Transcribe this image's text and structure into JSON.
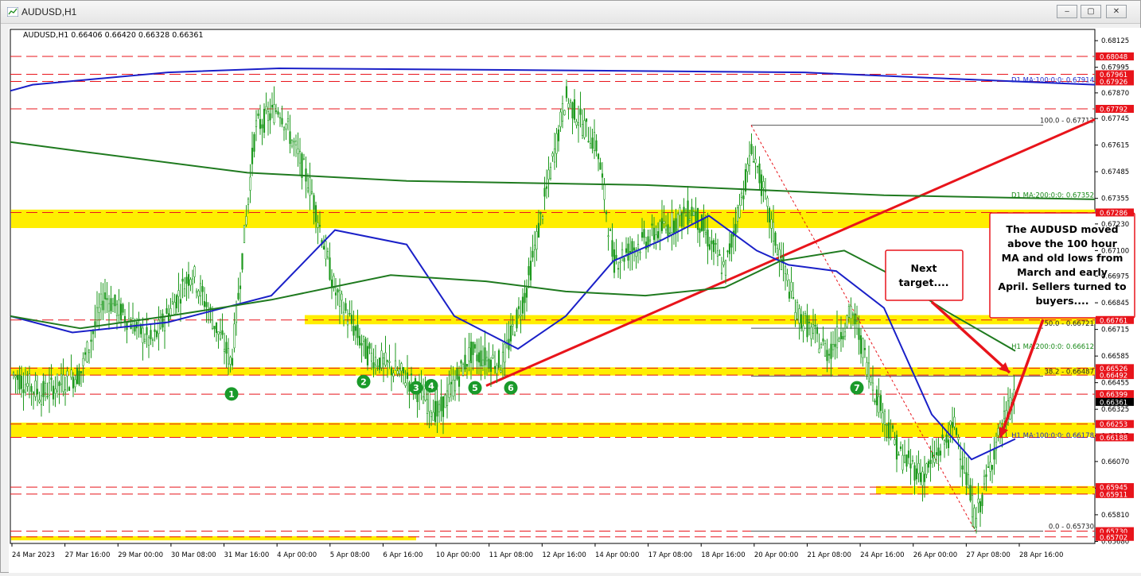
{
  "window": {
    "title": "AUDUSD,H1",
    "controls": {
      "minimize": "‒",
      "maximize": "▢",
      "close": "✕"
    }
  },
  "chart_data": {
    "type": "candlestick",
    "symbol_header": "AUDUSD,H1  0.66406 0.66420 0.66328 0.66361",
    "ylim": [
      0.6567,
      0.6818
    ],
    "price_axis_ticks": [
      "0.68125",
      "0.67995",
      "0.67870",
      "0.67745",
      "0.67615",
      "0.67485",
      "0.67355",
      "0.67230",
      "0.67100",
      "0.66975",
      "0.66845",
      "0.66715",
      "0.66585",
      "0.66455",
      "0.66325",
      "0.66195",
      "0.66070",
      "0.65940",
      "0.65810",
      "0.65680"
    ],
    "time_axis_labels": [
      "24 Mar 2023",
      "27 Mar 16:00",
      "29 Mar 00:00",
      "30 Mar 08:00",
      "31 Mar 16:00",
      "4 Apr 00:00",
      "5 Apr 08:00",
      "6 Apr 16:00",
      "10 Apr 00:00",
      "11 Apr 08:00",
      "12 Apr 16:00",
      "14 Apr 00:00",
      "17 Apr 08:00",
      "18 Apr 16:00",
      "20 Apr 00:00",
      "21 Apr 08:00",
      "24 Apr 16:00",
      "26 Apr 00:00",
      "27 Apr 08:00",
      "28 Apr 16:00"
    ],
    "price_labels": [
      {
        "text": "0.68048",
        "value": 0.68048,
        "color": "#e8141b"
      },
      {
        "text": "0.67961",
        "value": 0.67961,
        "color": "#e8141b"
      },
      {
        "text": "0.67926",
        "value": 0.67926,
        "color": "#e8141b"
      },
      {
        "text": "0.67792",
        "value": 0.67792,
        "color": "#e8141b"
      },
      {
        "text": "0.67286",
        "value": 0.67286,
        "color": "#e8141b"
      },
      {
        "text": "0.66761",
        "value": 0.66761,
        "color": "#e8141b"
      },
      {
        "text": "0.66526",
        "value": 0.66526,
        "color": "#e8141b"
      },
      {
        "text": "0.66492",
        "value": 0.66492,
        "color": "#e8141b"
      },
      {
        "text": "0.66399",
        "value": 0.66399,
        "color": "#e8141b"
      },
      {
        "text": "0.66361",
        "value": 0.66361,
        "color": "#000000"
      },
      {
        "text": "0.66253",
        "value": 0.66253,
        "color": "#e8141b"
      },
      {
        "text": "0.66188",
        "value": 0.66188,
        "color": "#e8141b"
      },
      {
        "text": "0.65945",
        "value": 0.65945,
        "color": "#e8141b"
      },
      {
        "text": "0.65911",
        "value": 0.65911,
        "color": "#e8141b"
      },
      {
        "text": "0.65730",
        "value": 0.6573,
        "color": "#e8141b"
      },
      {
        "text": "0.65702",
        "value": 0.65702,
        "color": "#e8141b"
      }
    ],
    "horizontal_levels": [
      0.68048,
      0.67961,
      0.67926,
      0.67792,
      0.67286,
      0.66761,
      0.66526,
      0.66492,
      0.66399,
      0.66253,
      0.66188,
      0.65945,
      0.65911,
      0.6573,
      0.65702
    ],
    "support_resistance_zones": [
      {
        "from": 0.673,
        "to": 0.6721
      },
      {
        "from": 0.66785,
        "to": 0.6674
      },
      {
        "from": 0.6653,
        "to": 0.6649
      },
      {
        "from": 0.6626,
        "to": 0.6619
      },
      {
        "from": 0.6595,
        "to": 0.6591
      },
      {
        "from": 0.65705,
        "to": 0.65685
      }
    ],
    "ma_labels": [
      {
        "text": "D1 MA:100:0:0: 0.67914",
        "value": 0.67914,
        "color": "#1e2acc"
      },
      {
        "text": "D1 MA:200:0:0: 0.67352",
        "value": 0.67352,
        "color": "#1a8a1a"
      },
      {
        "text": "H1 MA:200:0:0: 0.66612",
        "value": 0.66612,
        "color": "#1a8a1a"
      },
      {
        "text": "H1 MA:100:0:0: 0.66178",
        "value": 0.66178,
        "color": "#1e2acc"
      }
    ],
    "fibonacci": [
      {
        "text": "100.0 - 0.67712",
        "value": 0.67712
      },
      {
        "text": "50.0 - 0.66721",
        "value": 0.66721
      },
      {
        "text": "38.2 - 0.66487",
        "value": 0.66487
      },
      {
        "text": "0.0 - 0.65730",
        "value": 0.6573
      }
    ],
    "markers": [
      "1",
      "2",
      "3",
      "4",
      "5",
      "6",
      "7"
    ],
    "annotations": [
      {
        "text": "Next target...."
      },
      {
        "text": "The AUDUSD moved above the 100 hour MA and old lows from March and early April. Sellers turned to buyers...."
      }
    ],
    "colors": {
      "candle": "#1f9a1f",
      "ma100": "#1a20c8",
      "ma200": "#1f7a1f",
      "zone": "#ffee00",
      "trendline": "#e8141b"
    }
  }
}
